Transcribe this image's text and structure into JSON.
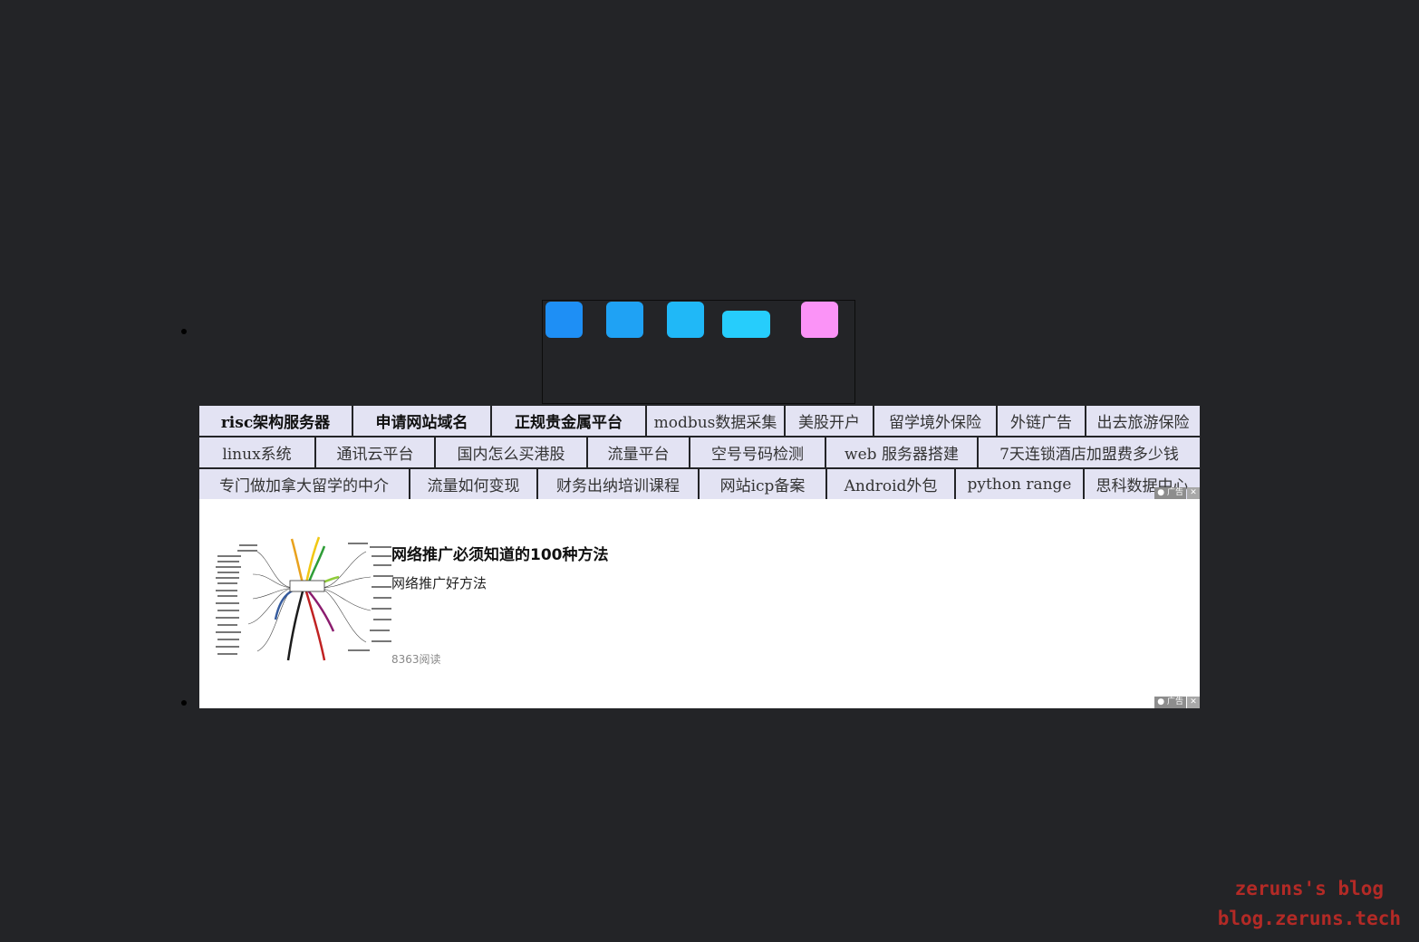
{
  "loader": {
    "squares": [
      {
        "color": "#1e8ff5"
      },
      {
        "color": "#1fa2f4"
      },
      {
        "color": "#20b8f7"
      },
      {
        "color": "#26cdfc"
      },
      {
        "color": "#fb93f7"
      }
    ]
  },
  "link_unit": {
    "rows": [
      [
        {
          "label": "risc架构服务器",
          "bold": true
        },
        {
          "label": "申请网站域名",
          "bold": true
        },
        {
          "label": "正规贵金属平台",
          "bold": true
        },
        {
          "label": "modbus数据采集",
          "bold": false
        },
        {
          "label": "美股开户",
          "bold": false
        },
        {
          "label": "留学境外保险",
          "bold": false
        },
        {
          "label": "外链广告",
          "bold": false
        },
        {
          "label": "出去旅游保险",
          "bold": false
        }
      ],
      [
        {
          "label": "linux系统",
          "bold": false
        },
        {
          "label": "通讯云平台",
          "bold": false
        },
        {
          "label": "国内怎么买港股",
          "bold": false
        },
        {
          "label": "流量平台",
          "bold": false
        },
        {
          "label": "空号号码检测",
          "bold": false
        },
        {
          "label": "web 服务器搭建",
          "bold": false
        },
        {
          "label": "7天连锁酒店加盟费多少钱",
          "bold": false
        }
      ],
      [
        {
          "label": "专门做加拿大留学的中介",
          "bold": false
        },
        {
          "label": "流量如何变现",
          "bold": false
        },
        {
          "label": "财务出纳培训课程",
          "bold": false
        },
        {
          "label": "网站icp备案",
          "bold": false
        },
        {
          "label": "Android外包",
          "bold": false
        },
        {
          "label": "python range",
          "bold": false
        },
        {
          "label": "思科数据中心",
          "bold": false
        }
      ]
    ]
  },
  "ad": {
    "tag_label": "广告",
    "close_label": "✕",
    "title": "网络推广必须知道的100种方法",
    "subtitle": "网络推广好方法",
    "reads": "8363阅读"
  },
  "watermark": {
    "line1": "zeruns's blog",
    "line2": "blog.zeruns.tech"
  }
}
